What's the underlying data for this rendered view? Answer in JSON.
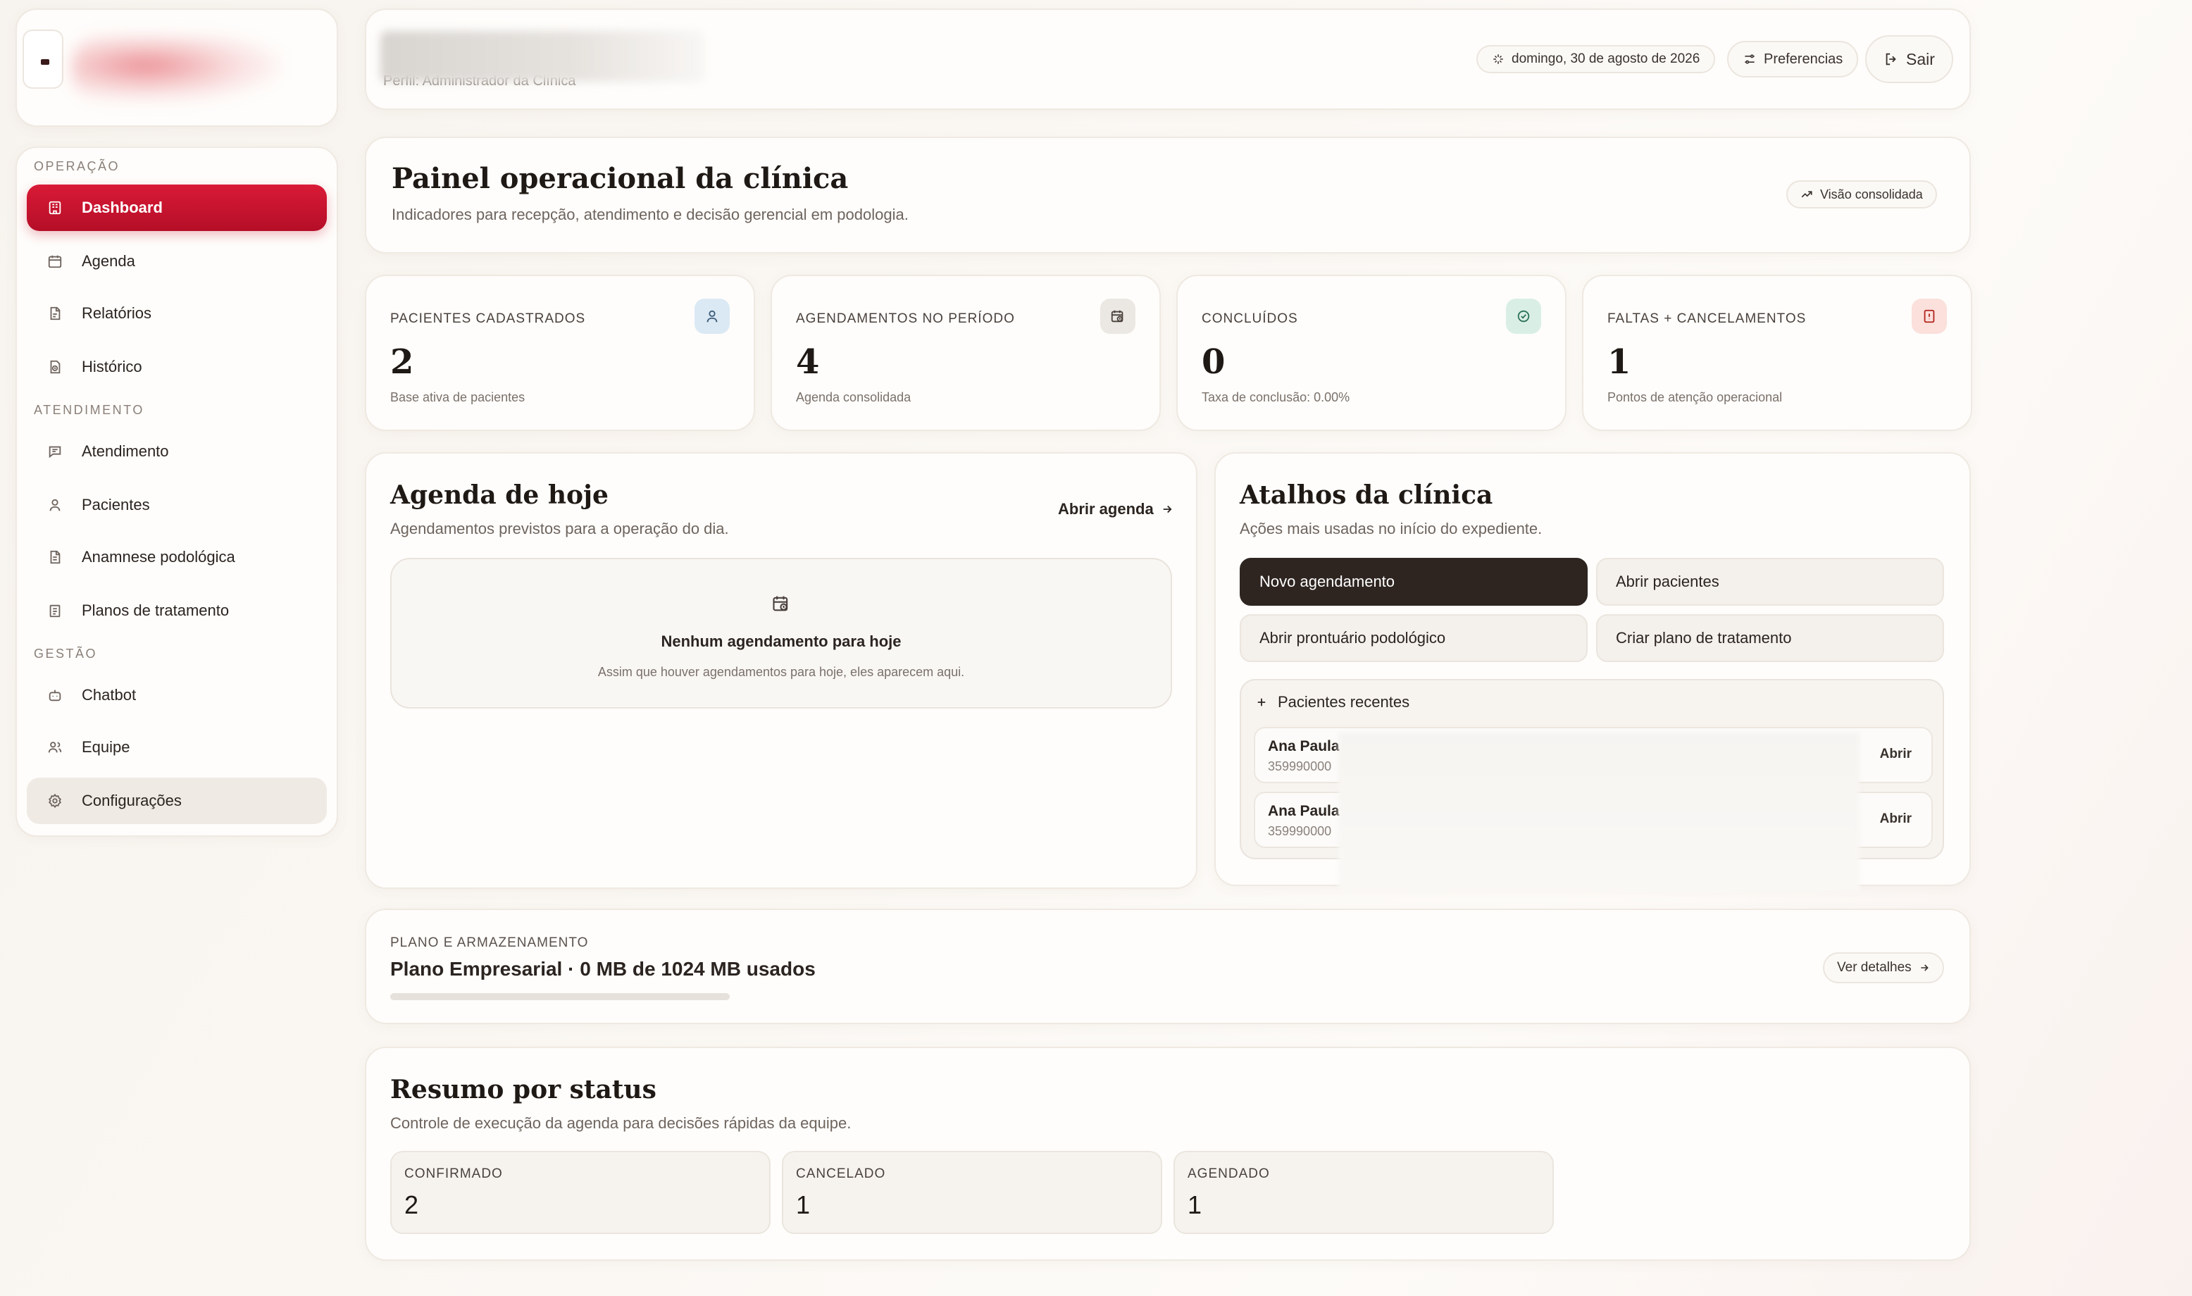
{
  "header": {
    "profile_line": "Perfil: Administrador da Clínica",
    "date": "domingo, 30 de agosto de 2026",
    "preferences_label": "Preferencias",
    "logout_label": "Sair"
  },
  "sidebar": {
    "sections": [
      {
        "title": "OPERAÇÃO"
      },
      {
        "title": "ATENDIMENTO"
      },
      {
        "title": "GESTÃO"
      }
    ],
    "items": [
      {
        "label": "Dashboard",
        "icon": "dashboard-icon"
      },
      {
        "label": "Agenda",
        "icon": "calendar-icon"
      },
      {
        "label": "Relatórios",
        "icon": "report-icon"
      },
      {
        "label": "Histórico",
        "icon": "history-icon"
      },
      {
        "label": "Atendimento",
        "icon": "chat-icon"
      },
      {
        "label": "Pacientes",
        "icon": "user-icon"
      },
      {
        "label": "Anamnese podológica",
        "icon": "document-icon"
      },
      {
        "label": "Planos de tratamento",
        "icon": "clipboard-icon"
      },
      {
        "label": "Chatbot",
        "icon": "bot-icon"
      },
      {
        "label": "Equipe",
        "icon": "team-icon"
      },
      {
        "label": "Configurações",
        "icon": "gear-icon"
      }
    ],
    "active_item": "Dashboard"
  },
  "panel": {
    "title": "Painel operacional da clínica",
    "subtitle": "Indicadores para recepção, atendimento e decisão gerencial em podologia.",
    "badge": "Visão consolidada"
  },
  "stats": [
    {
      "label": "PACIENTES CADASTRADOS",
      "value": "2",
      "description": "Base ativa de pacientes",
      "icon": "user-icon",
      "color": "#dbe9f4"
    },
    {
      "label": "AGENDAMENTOS NO PERÍODO",
      "value": "4",
      "description": "Agenda consolidada",
      "icon": "calendar-clock-icon",
      "color": "#ebe7e2"
    },
    {
      "label": "CONCLUÍDOS",
      "value": "0",
      "description": "Taxa de conclusão: 0.00%",
      "icon": "check-circle-icon",
      "color": "#d9efe6"
    },
    {
      "label": "FALTAS + CANCELAMENTOS",
      "value": "1",
      "description": "Pontos de atenção operacional",
      "icon": "alert-doc-icon",
      "color": "#fbe0dc"
    }
  ],
  "agenda": {
    "title": "Agenda de hoje",
    "subtitle": "Agendamentos previstos para a operação do dia.",
    "open_link": "Abrir agenda",
    "empty_title": "Nenhum agendamento para hoje",
    "empty_text": "Assim que houver agendamentos para hoje, eles aparecem aqui."
  },
  "shortcuts": {
    "title": "Atalhos da clínica",
    "subtitle": "Ações mais usadas no início do expediente.",
    "buttons": [
      {
        "label": "Novo agendamento"
      },
      {
        "label": "Abrir pacientes"
      },
      {
        "label": "Abrir prontuário podológico"
      },
      {
        "label": "Criar plano de tratamento"
      }
    ],
    "recent_title": "Pacientes recentes",
    "recent": [
      {
        "name": "Ana Paula",
        "phone": "359990000",
        "action": "Abrir"
      },
      {
        "name": "Ana Paula",
        "phone": "359990000",
        "action": "Abrir"
      }
    ]
  },
  "plan": {
    "label": "PLANO E ARMAZENAMENTO",
    "value": "Plano Empresarial · 0 MB de 1024 MB usados",
    "usage_fraction": 0.0,
    "details_label": "Ver detalhes"
  },
  "summary": {
    "title": "Resumo por status",
    "subtitle": "Controle de execução da agenda para decisões rápidas da equipe.",
    "statuses": [
      {
        "label": "CONFIRMADO",
        "value": "2"
      },
      {
        "label": "CANCELADO",
        "value": "1"
      },
      {
        "label": "AGENDADO",
        "value": "1"
      }
    ]
  },
  "colors": {
    "accent": "#c8102e",
    "dark_button": "#2e2521",
    "background": "#f9f5f0"
  }
}
